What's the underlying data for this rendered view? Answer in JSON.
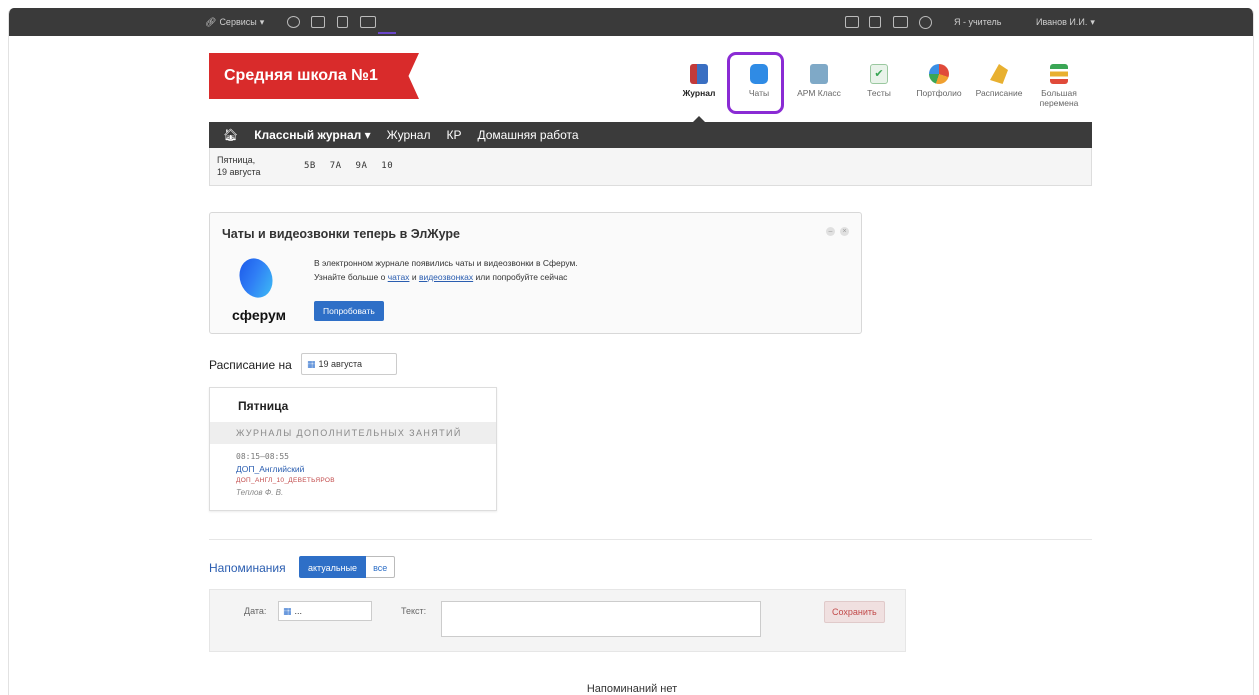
{
  "topbar": {
    "services_label": "Сервисы",
    "role_label": "Я - учитель",
    "user_label": "Иванов И.И."
  },
  "header": {
    "school_name": "Средняя школа №1",
    "apps": [
      {
        "label": "Журнал",
        "icon": "journal-icon",
        "color": "#c23a3a"
      },
      {
        "label": "Чаты",
        "icon": "chat-icon",
        "color": "#2f8be5"
      },
      {
        "label": "АРМ Класс",
        "icon": "class-icon",
        "color": "#5a8fb0"
      },
      {
        "label": "Тесты",
        "icon": "tests-icon",
        "color": "#3aa655"
      },
      {
        "label": "Портфолио",
        "icon": "portfolio-icon",
        "color": "#3a8fe5"
      },
      {
        "label": "Расписание",
        "icon": "schedule-icon",
        "color": "#e8b030"
      },
      {
        "label": "Большая перемена",
        "icon": "big-break-icon",
        "color": "#e04a3a"
      }
    ]
  },
  "nav": {
    "items": [
      "Классный журнал",
      "Журнал",
      "КР",
      "Домашняя работа"
    ]
  },
  "subnav": {
    "date_line1": "Пятница,",
    "date_line2": "19 августа",
    "classes": [
      "5В",
      "7А",
      "9А",
      "10"
    ]
  },
  "banner": {
    "title": "Чаты и видеозвонки теперь в ЭлЖуре",
    "line1": "В электронном журнале появились чаты и видеозвонки в Сферум.",
    "line2_prefix": "Узнайте больше о",
    "link_chats": "чатах",
    "line2_and": "и",
    "link_video": "видеозвонках",
    "line2_suffix": "или попробуйте сейчас",
    "logo_text": "сферум",
    "try_button": "Попробовать"
  },
  "schedule": {
    "label": "Расписание на",
    "date_value": "19 августа",
    "day_name": "Пятница",
    "section_title": "ЖУРНАЛЫ ДОПОЛНИТЕЛЬНЫХ ЗАНЯТИЙ",
    "lesson": {
      "time": "08:15–08:55",
      "subject": "ДОП_Английский",
      "group": "ДОП_АНГЛ_10_ДЕВЕТЬЯРОВ",
      "teacher": "Теплов Ф. В."
    }
  },
  "reminders": {
    "title": "Напоминания",
    "tab_actual": "актуальные",
    "tab_all": "все",
    "date_label": "Дата:",
    "date_placeholder": "...",
    "text_label": "Текст:",
    "save_button": "Сохранить",
    "empty_text": "Напоминаний нет"
  },
  "colors": {
    "accent_red": "#d92b2b",
    "accent_blue": "#2e6fc7",
    "highlight_purple": "#8a2bd4",
    "dark_bar": "#3a3a3a"
  }
}
